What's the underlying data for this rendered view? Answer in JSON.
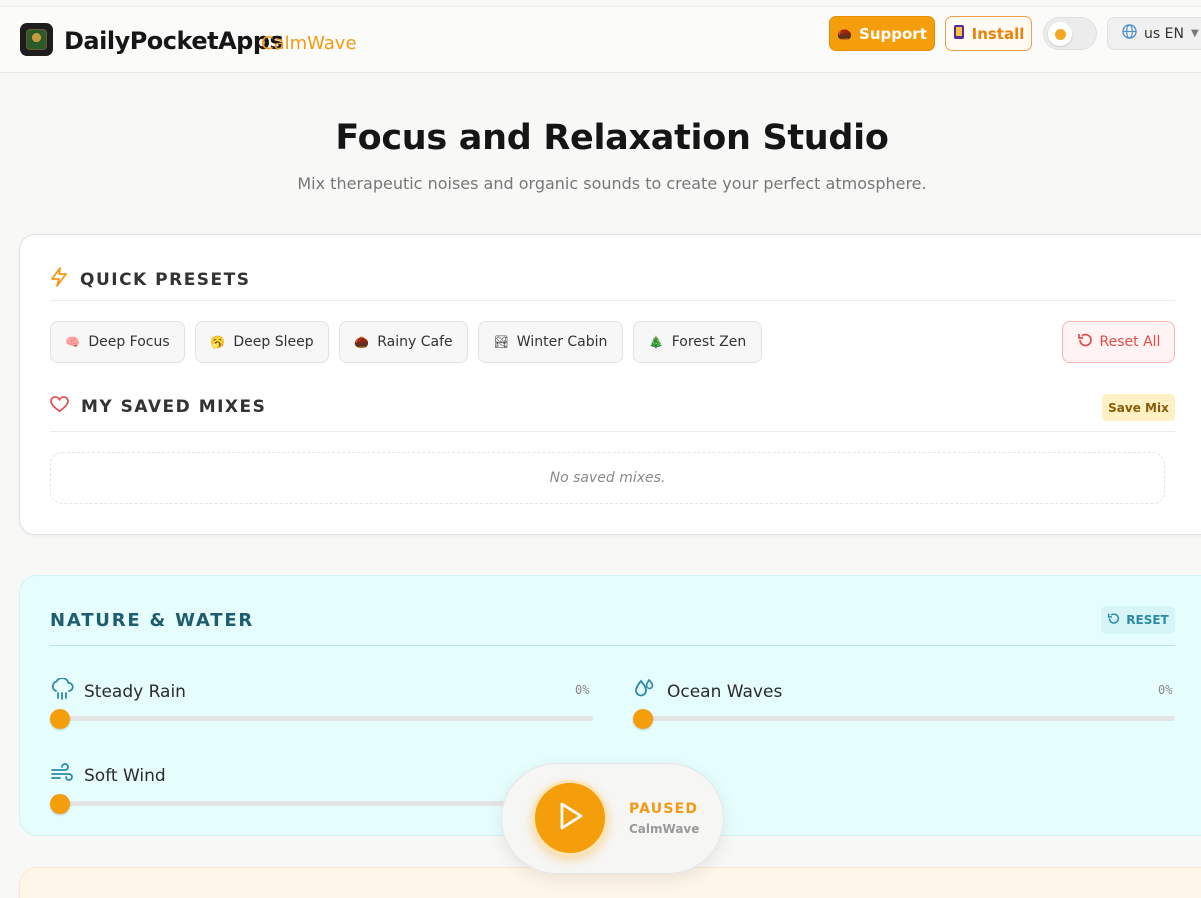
{
  "header": {
    "brand": "DailyPocketApps",
    "app_name": "CalmWave",
    "support_label": "Support",
    "install_label": "Install",
    "language_label": "us EN",
    "accent_color": "#f59e0b"
  },
  "hero": {
    "title": "Focus and Relaxation Studio",
    "subtitle": "Mix therapeutic noises and organic sounds to create your perfect atmosphere."
  },
  "presets": {
    "heading": "QUICK PRESETS",
    "items": [
      {
        "emoji": "🧠",
        "label": "Deep Focus"
      },
      {
        "emoji": "🥱",
        "label": "Deep Sleep"
      },
      {
        "emoji": "🌰",
        "label": "Rainy Cafe"
      },
      {
        "emoji": "🏞",
        "label": "Winter Cabin"
      },
      {
        "emoji": "🎄",
        "label": "Forest Zen"
      }
    ],
    "reset_all_label": "Reset All"
  },
  "saved": {
    "heading": "MY SAVED MIXES",
    "save_label": "Save Mix",
    "empty_text": "No saved mixes."
  },
  "nature": {
    "heading": "NATURE & WATER",
    "reset_label": "RESET",
    "sounds": [
      {
        "label": "Steady Rain",
        "value": "0%",
        "icon": "cloud-rain-icon"
      },
      {
        "label": "Ocean Waves",
        "value": "0%",
        "icon": "droplets-icon"
      },
      {
        "label": "Soft Wind",
        "value": "",
        "icon": "wind-icon"
      }
    ]
  },
  "player": {
    "status": "PAUSED",
    "name": "CalmWave"
  }
}
